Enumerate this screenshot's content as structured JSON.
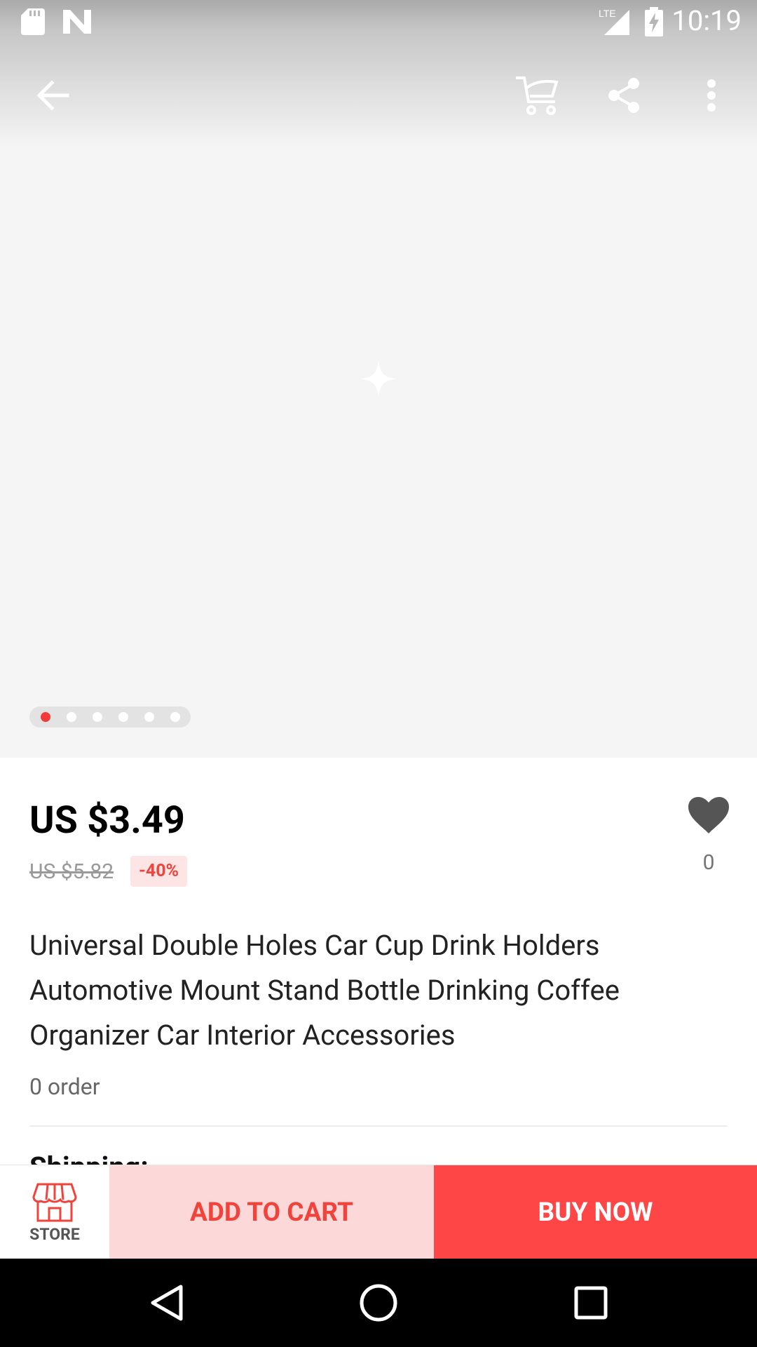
{
  "status_bar": {
    "time": "10:19",
    "network": "LTE",
    "icons": [
      "sd-card-icon",
      "n-notification-icon",
      "lte-signal-icon",
      "battery-charging-icon"
    ]
  },
  "toolbar": {
    "icons": [
      "back-arrow-icon",
      "cart-icon",
      "share-icon",
      "more-vert-icon"
    ]
  },
  "gallery": {
    "image_count": 6,
    "active_index": 0,
    "accent": "#f23c3c"
  },
  "product": {
    "price": "US $3.49",
    "original_price": "US $5.82",
    "discount": "-40%",
    "wishlist_count": "0",
    "title": "Universal Double Holes Car Cup Drink Holders Automotive Mount Stand Bottle Drinking Coffee Organizer Car Interior Accessories",
    "orders": "0 order",
    "next_section": "Shipping:"
  },
  "actions": {
    "store_label": "STORE",
    "add_to_cart": "ADD TO CART",
    "buy_now": "BUY NOW",
    "colors": {
      "add_to_cart_bg": "#fdd8d8",
      "buy_now_bg": "#fe4646",
      "accent": "#f0433b"
    }
  },
  "system_nav": {
    "icons": [
      "back-triangle-icon",
      "home-circle-icon",
      "recents-square-icon"
    ]
  }
}
